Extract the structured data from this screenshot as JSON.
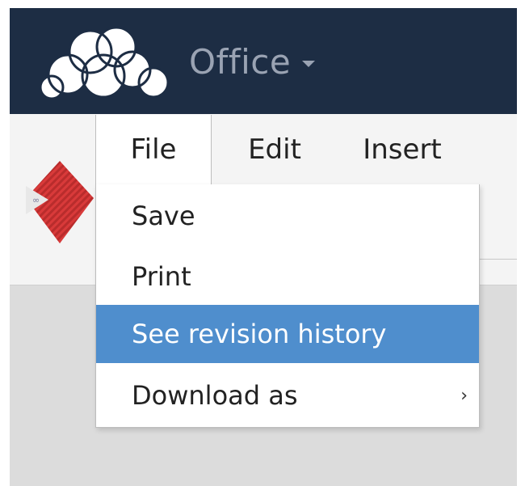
{
  "header": {
    "app_name": "Office",
    "colors": {
      "bar": "#1d2d44",
      "app_text": "#9aa3b3"
    }
  },
  "icons": {
    "logo": "cloud-logo-icon",
    "app_switch": "caret-down-icon",
    "document": "document-icon",
    "submenu": "chevron-right-icon"
  },
  "menubar": {
    "tabs": [
      {
        "label": "File",
        "active": true
      },
      {
        "label": "Edit",
        "active": false
      },
      {
        "label": "Insert",
        "active": false
      }
    ]
  },
  "file_menu": {
    "items": [
      {
        "label": "Save"
      },
      {
        "label": "Print"
      },
      {
        "label": "See revision history",
        "highlighted": true
      },
      {
        "label": "Download as",
        "has_submenu": true,
        "submenu_glyph": "›"
      }
    ],
    "highlight_color": "#4f8ecd"
  }
}
